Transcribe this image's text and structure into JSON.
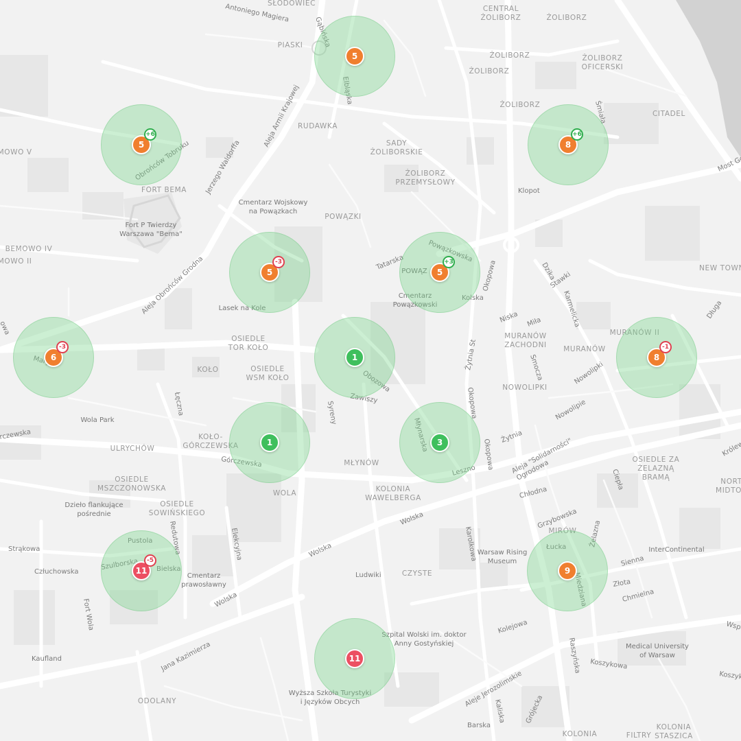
{
  "colors": {
    "background": "#f2f2f2",
    "road": "#ffffff",
    "block": "#e6e6e6",
    "river": "#d2d2d2",
    "cluster_fill": "rgba(120,212,140,0.38)",
    "marker_orange": "#f07f2f",
    "marker_green": "#3fbf5d",
    "marker_red": "#ec4f62",
    "badge_up": "#2fae4d",
    "badge_down": "#e04050"
  },
  "districts": {
    "slodowiec": "SŁODOWIEC",
    "central_zoliborz": "CENTRAL",
    "central_zoliborz_2": "ŻOLIBORZ",
    "zoliborz_1": "ŻOLIBORZ",
    "zoliborz_2": "ŻOLIBORZ",
    "zoliborz_3": "ŻOLIBORZ",
    "zoliborz_4": "ŻOLIBORZ",
    "zoliborz_oficerski_1": "ŻOLIBORZ",
    "zoliborz_oficerski_2": "OFICERSKI",
    "piaski": "PIASKI",
    "rudawka": "RUDAWKA",
    "sady_1": "SADY",
    "sady_2": "ŻOLIBORSKIE",
    "zol_przem_1": "ŻOLIBORZ",
    "zol_przem_2": "PRZEMYSŁOWY",
    "citadel": "CITADEL",
    "bemowo_v": "EMOWO V",
    "fort_bema": "FORT BEMA",
    "powazki": "POWĄZKI",
    "bemowo_iv": "BEMOWO IV",
    "bemowo_ii": "EMOWO II",
    "new_town": "NEW TOWN",
    "tor_kolo_1": "OSIEDLE",
    "tor_kolo_2": "TOR KOŁO",
    "kolo": "KOŁO",
    "wsm_kolo_1": "OSIEDLE",
    "wsm_kolo_2": "WSM KOŁO",
    "muranow_zach_1": "MURANÓW",
    "muranow_zach_2": "ZACHODNI",
    "muranow": "MURANÓW",
    "muranow_ii": "MURANÓW II",
    "nowolipki": "NOWOLIPKI",
    "kolo_gorcz_1": "KOŁO-",
    "kolo_gorcz_2": "GÓRCZEWSKA",
    "ulrychow": "ULRYCHÓW",
    "mlynow": "MŁYNÓW",
    "mszczon_1": "OSIEDLE",
    "mszczon_2": "MSZCZONOWSKA",
    "wola": "WOLA",
    "kol_waw_1": "KOLONIA",
    "kol_waw_2": "WAWELBERGA",
    "sowin_1": "OSIEDLE",
    "sowin_2": "SOWIŃSKIEGO",
    "zel_brama_1": "OSIEDLE ZA",
    "zel_brama_2": "ŻELAZNĄ",
    "zel_brama_3": "BRAMĄ",
    "nort_1": "NORT",
    "nort_2": "MIDTO",
    "mirow": "MIRÓW",
    "czyste": "CZYSTE",
    "odolany": "ODOLANY",
    "kolonia_bottom": "KOLONIA",
    "filtry": "FILTRY",
    "kol_staszica_1": "KOLONIA",
    "kol_staszica_2": "STASZICA"
  },
  "streets": {
    "antoniego": "Antoniego Magiera",
    "gabinska": "Gąbińska",
    "elblaska": "Elbląska",
    "aleja_armii": "Aleja Armii Krajowej",
    "obroncow_tobruku": "Obrońców Tobruku",
    "jerzego": "Jerzego Waldorffa",
    "smiala": "Śmiała",
    "most_gd": "Most Gd",
    "klopot": "Klopot",
    "powazkowska": "Powązkowska",
    "tatarska": "Tatarska",
    "kolska": "Kolska",
    "okopowa_top": "Okopowa",
    "dzika": "Dzika",
    "stawki": "Stawki",
    "karmelicka": "Karmelicka",
    "dluga": "Długa",
    "aleja_obroncow_grodna": "Aleja Obrońców Grodna",
    "niska": "Niska",
    "mila": "Miła",
    "zytnia_st": "Żytnia St",
    "smocza": "Smocza",
    "nowolipki_st": "Nowolipki",
    "nowolipie": "Nowolipie",
    "obozowa": "Obozowa",
    "zawiszy": "Zawiszy",
    "syreny": "Syreny",
    "leczna": "Łęczna",
    "okopowa_mid": "Okopowa",
    "okopowa_mid2": "Okopowa",
    "zytnia": "Żytnia",
    "gorczewska_left": "rczewska",
    "gorczewska": "Górczewska",
    "mlynarska": "Młynarska",
    "leszno": "Leszno",
    "solidarnosci": "Aleja \"Solidarności\"",
    "ogrodowa": "Ogrodowa",
    "chlodna": "Chłodna",
    "ciepla": "Ciepła",
    "krolewska": "Królew",
    "grzybowska": "Grzybowska",
    "wolska": "Wolska",
    "wolska2": "Wolska",
    "wolska3": "Wolska",
    "elekcyjna": "Elekcyjna",
    "redutowa": "Redutowa",
    "strakowa": "Strąkowa",
    "czluchowska": "Człuchowska",
    "szulborska": "Szulborska",
    "pustola": "Pustola",
    "bielska": "Bielska",
    "fort_wola": "Fort Wola",
    "karolkowa": "Karolkowa",
    "ludwiki": "Ludwiki",
    "lucka": "Łucka",
    "zelazna": "Żelazna",
    "miedziana": "Miedziana",
    "sienna": "Sienna",
    "zlota": "Złota",
    "chmielna": "Chmielna",
    "jana_kazimierza": "Jana Kazimierza",
    "kolejowa": "Kolejowa",
    "aleje_jerozolimskie": "Aleje Jerozolimskie",
    "grojecka": "Grójecka",
    "kaliska": "Kaliska",
    "raszynska": "Raszyńska",
    "koszykowa": "Koszykowa",
    "koszyk": "Koszyk",
    "barska": "Barska",
    "wspol": "Wspó",
    "lowa": "owa",
    "maryn": "Maryn"
  },
  "pois": {
    "cmentarz_wojskowy_1": "Cmentarz Wojskowy",
    "cmentarz_wojskowy_2": "na Powązkach",
    "fort_p_1": "Fort P Twierdzy",
    "fort_p_2": "Warszawa \"Bema\"",
    "lasek_na_kole": "Lasek na Kole",
    "cmentarz_powazkowski_1": "Cmentarz",
    "cmentarz_powazkowski_2": "Powązkowski",
    "powaz": "POWĄZ",
    "wola_park": "Wola Park",
    "dzielo_1": "Dzieło flankujące",
    "dzielo_2": "pośrednie",
    "cmentarz_praw_1": "Cmentarz",
    "cmentarz_praw_2": "prawosławny",
    "warsaw_rising_1": "Warsaw Rising",
    "warsaw_rising_2": "Museum",
    "intercontinental": "InterContinental",
    "szpital_1": "Szpital Wolski im. doktor",
    "szpital_2": "Anny Gostyńskiej",
    "medical_1": "Medical University",
    "medical_2": "of Warsaw",
    "kaufland": "Kaufland",
    "wyzsza_1": "Wyższa Szkoła Turystyki",
    "wyzsza_2": "i Języków Obcych"
  },
  "clusters": [
    {
      "id": "piaski",
      "count": "5",
      "color": "orange",
      "badge": null
    },
    {
      "id": "bemowo",
      "count": "5",
      "color": "orange",
      "badge": "+6",
      "badge_kind": "up"
    },
    {
      "id": "zoliborz",
      "count": "8",
      "color": "orange",
      "badge": "+6",
      "badge_kind": "up"
    },
    {
      "id": "kolo",
      "count": "5",
      "color": "orange",
      "badge": "-3",
      "badge_kind": "down"
    },
    {
      "id": "powazki",
      "count": "5",
      "color": "orange",
      "badge": "+3",
      "badge_kind": "up"
    },
    {
      "id": "maryn",
      "count": "6",
      "color": "orange",
      "badge": "-3",
      "badge_kind": "down"
    },
    {
      "id": "obozowa",
      "count": "1",
      "color": "green",
      "badge": null
    },
    {
      "id": "muranow",
      "count": "8",
      "color": "orange",
      "badge": "-1",
      "badge_kind": "down"
    },
    {
      "id": "gorczewska",
      "count": "1",
      "color": "green",
      "badge": null
    },
    {
      "id": "mlynarska",
      "count": "3",
      "color": "green",
      "badge": null
    },
    {
      "id": "szulborska",
      "count": "11",
      "color": "red",
      "badge": "-5",
      "badge_kind": "down"
    },
    {
      "id": "mirow",
      "count": "9",
      "color": "orange",
      "badge": null
    },
    {
      "id": "czyste",
      "count": "11",
      "color": "red",
      "badge": null
    }
  ]
}
